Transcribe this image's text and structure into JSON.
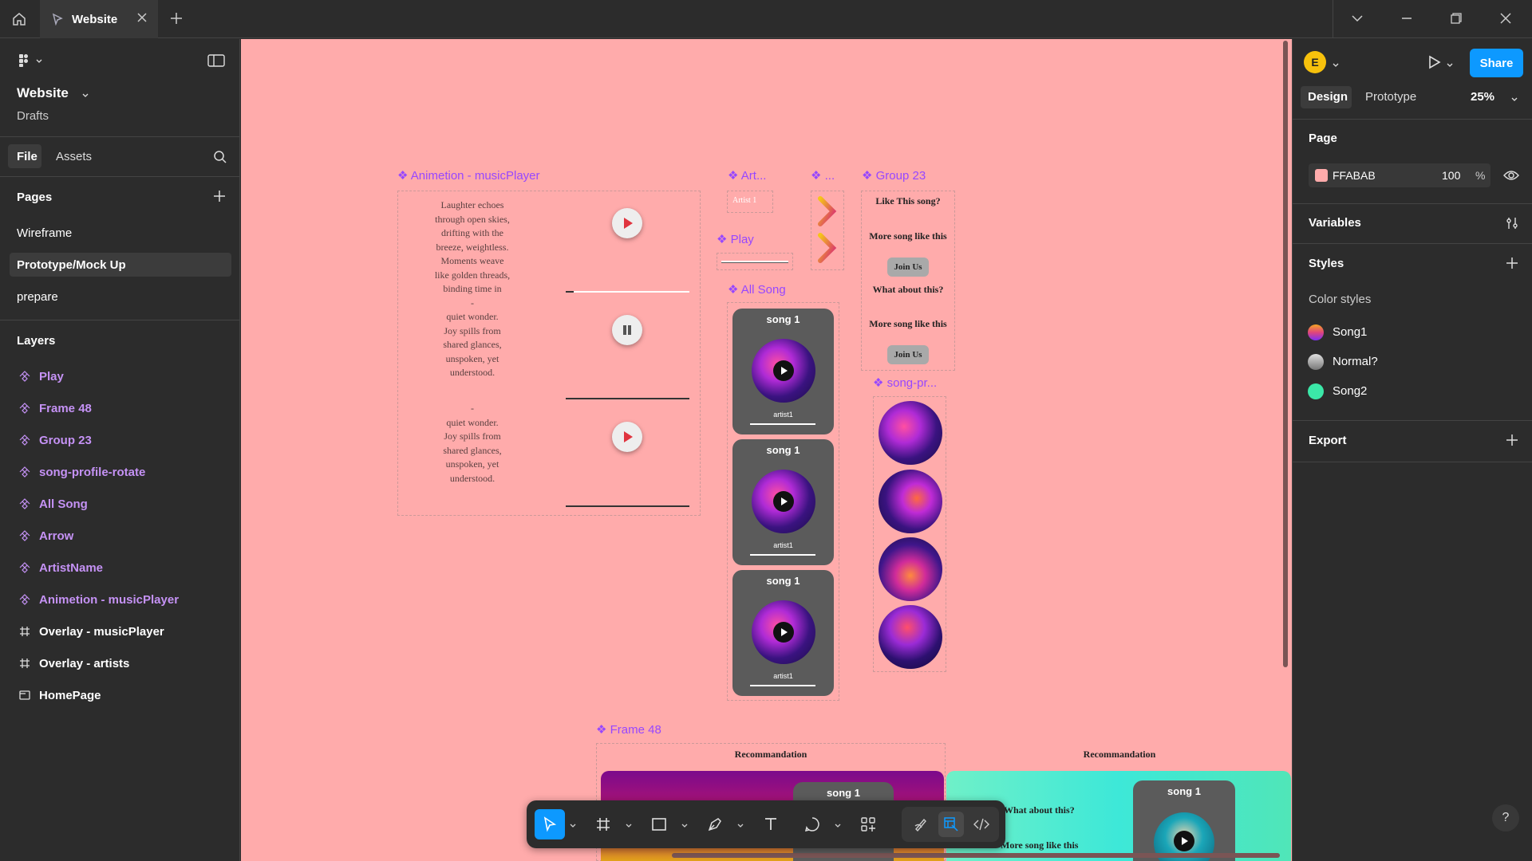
{
  "titlebar": {
    "tab_title": "Website"
  },
  "left": {
    "file_name": "Website",
    "location": "Drafts",
    "tabs": [
      "File",
      "Assets"
    ],
    "pages_heading": "Pages",
    "pages": [
      "Wireframe",
      "Prototype/Mock Up",
      "prepare"
    ],
    "layers_heading": "Layers",
    "layers": [
      {
        "label": "Play",
        "icon": "component-icon"
      },
      {
        "label": "Frame 48",
        "icon": "component-icon"
      },
      {
        "label": "Group 23",
        "icon": "component-icon"
      },
      {
        "label": "song-profile-rotate",
        "icon": "component-icon"
      },
      {
        "label": "All Song",
        "icon": "component-icon"
      },
      {
        "label": "Arrow",
        "icon": "component-icon"
      },
      {
        "label": "ArtistName",
        "icon": "component-icon"
      },
      {
        "label": "Animetion - musicPlayer",
        "icon": "component-icon"
      },
      {
        "label": "Overlay - musicPlayer",
        "icon": "frame-icon"
      },
      {
        "label": "Overlay - artists",
        "icon": "frame-icon"
      },
      {
        "label": "HomePage",
        "icon": "section-icon"
      }
    ]
  },
  "right": {
    "avatar_letter": "E",
    "share_label": "Share",
    "tabs": [
      "Design",
      "Prototype"
    ],
    "zoom": "25%",
    "page_heading": "Page",
    "page_color_hex": "FFABAB",
    "page_opacity": "100",
    "percent_sign": "%",
    "variables_heading": "Variables",
    "styles_heading": "Styles",
    "color_styles_heading": "Color styles",
    "color_styles": [
      {
        "name": "Song1",
        "swatch": "linear-gradient(#f5a623,#e0457b,#7b2ff7)"
      },
      {
        "name": "Normal?",
        "swatch": "linear-gradient(#e0e0e0,#777777)"
      },
      {
        "name": "Song2",
        "swatch": "#3be8a8"
      }
    ],
    "export_heading": "Export"
  },
  "canvas": {
    "background": "#FFABAB",
    "labels": {
      "animetion": "Animetion - musicPlayer",
      "art": "Art...",
      "arrow": "...",
      "group23": "Group 23",
      "play": "Play",
      "allsong": "All Song",
      "songpr": "song-pr...",
      "frame48": "Frame 48"
    },
    "poem_1": [
      "Laughter echoes",
      "through open skies,",
      "drifting   with the",
      "breeze, weightless.",
      "Moments weave",
      "like golden threads,",
      "binding   time in",
      "-",
      "quiet wonder.",
      "Joy spills   from",
      "shared glances,",
      "unspoken, yet",
      "understood."
    ],
    "poem_2": [
      "-",
      "quiet wonder.",
      "Joy spills   from",
      "shared glances,",
      "unspoken, yet",
      "understood."
    ],
    "artist_chip": "Artist 1",
    "group23_lines": [
      "Like This song?",
      "More song like this",
      "Join Us",
      "What about this?",
      "More song like this",
      "Join Us"
    ],
    "song_cards": [
      {
        "title": "song 1",
        "artist": "artist1"
      },
      {
        "title": "song 1",
        "artist": "artist1"
      },
      {
        "title": "song 1",
        "artist": "artist1"
      }
    ],
    "frame48": {
      "heading_left": "Recommandation",
      "heading_right": "Recommandation",
      "card_left_title": "song 1",
      "card_right_title": "song 1",
      "q1": "What about this?",
      "q2": "More song like this"
    }
  }
}
